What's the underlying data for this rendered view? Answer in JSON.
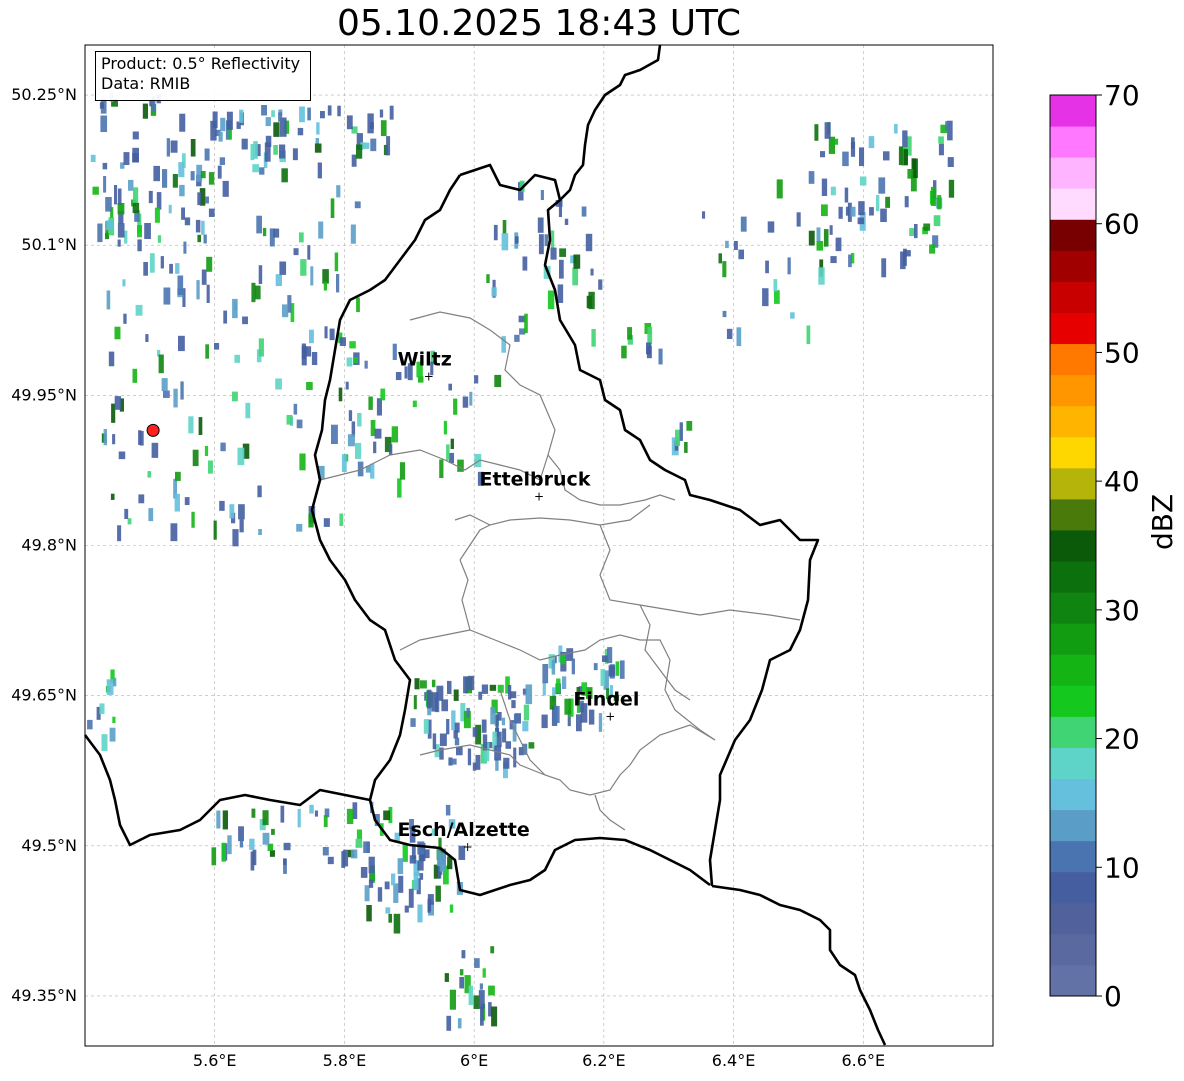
{
  "title": "05.10.2025 18:43 UTC",
  "info_box": {
    "product": "Product: 0.5° Reflectivity",
    "data_source": "Data: RMIB"
  },
  "map": {
    "lon_range": [
      5.4,
      6.8
    ],
    "lat_range": [
      49.3,
      50.3
    ],
    "lon_ticks": [
      "5.6°E",
      "5.8°E",
      "6°E",
      "6.2°E",
      "6.4°E",
      "6.6°E"
    ],
    "lat_ticks": [
      "50.25°N",
      "50.1°N",
      "49.95°N",
      "49.8°N",
      "49.65°N",
      "49.5°N",
      "49.35°N"
    ],
    "grid": true,
    "radar_site": {
      "lon": 5.505,
      "lat": 49.915,
      "color": "#ff2020"
    },
    "cities": [
      {
        "name": "Wiltz",
        "lon": 5.93,
        "lat": 49.97
      },
      {
        "name": "Ettelbruck",
        "lon": 6.1,
        "lat": 49.85
      },
      {
        "name": "Findel",
        "lon": 6.21,
        "lat": 49.63
      },
      {
        "name": "Esch/Alzette",
        "lon": 5.99,
        "lat": 49.5
      }
    ]
  },
  "colorbar": {
    "label": "dBZ",
    "min": 0,
    "max": 70,
    "ticks": [
      "70",
      "60",
      "50",
      "40",
      "30",
      "20",
      "10",
      "0"
    ],
    "colors": [
      "#6271a6",
      "#5a69a0",
      "#50619c",
      "#445ea0",
      "#4a74b0",
      "#5a9ec8",
      "#64c0dc",
      "#5ed4c8",
      "#40d474",
      "#14c81e",
      "#14b414",
      "#129c12",
      "#108410",
      "#0c700c",
      "#0a5a0a",
      "#4a7a0a",
      "#b4b40a",
      "#ffd700",
      "#ffb400",
      "#ff9600",
      "#ff7800",
      "#e60000",
      "#c80000",
      "#a00000",
      "#780000",
      "#ffdcff",
      "#ffb4ff",
      "#ff78ff",
      "#e632e6"
    ]
  }
}
